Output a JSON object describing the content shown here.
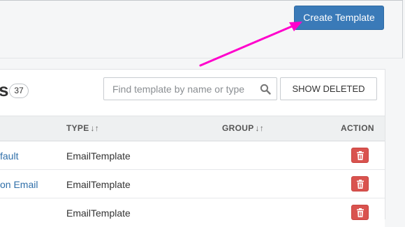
{
  "header": {
    "create_button_label": "Create Template"
  },
  "panel": {
    "title_fragment": "s",
    "count": "37",
    "search": {
      "placeholder": "Find template by name or type",
      "value": ""
    },
    "show_deleted_label": "SHOW DELETED"
  },
  "table": {
    "columns": {
      "type": "TYPE",
      "group": "GROUP",
      "action": "ACTION"
    },
    "rows": [
      {
        "name": "fault",
        "type": "EmailTemplate",
        "group": ""
      },
      {
        "name": "on Email",
        "type": "EmailTemplate",
        "group": ""
      },
      {
        "name": "",
        "type": "EmailTemplate",
        "group": ""
      }
    ]
  },
  "icons": {
    "search": "search-icon",
    "sort": "sort-icon",
    "delete": "trash-icon"
  },
  "colors": {
    "primary_button": "#3a7ab8",
    "danger_button": "#d9534f",
    "link": "#2f6fa9",
    "annotation_arrow": "#ff00cc"
  }
}
